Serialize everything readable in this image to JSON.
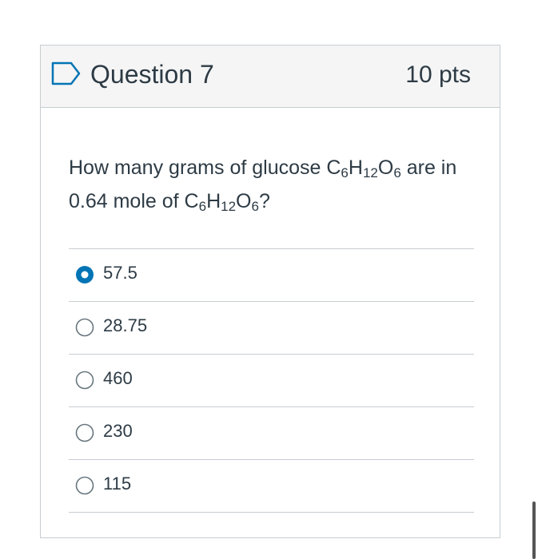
{
  "header": {
    "title": "Question 7",
    "points": "10 pts",
    "flag_icon": "bookmark-flag-icon"
  },
  "question": {
    "part1": "How many grams of glucose C",
    "s1": "6",
    "p2": "H",
    "s2": "12",
    "p3": "O",
    "s3": "6",
    "part4": " are in 0.64 mole of C",
    "s4": "6",
    "p5": "H",
    "s5": "12",
    "p6": "O",
    "s6": "6",
    "p7": "?"
  },
  "answers": [
    {
      "label": "57.5",
      "selected": true
    },
    {
      "label": "28.75",
      "selected": false
    },
    {
      "label": "460",
      "selected": false
    },
    {
      "label": "230",
      "selected": false
    },
    {
      "label": "115",
      "selected": false
    }
  ],
  "colors": {
    "accent": "#0374b5",
    "text": "#2d3b45",
    "border": "#c7cdd1",
    "header_bg": "#f5f5f5"
  }
}
